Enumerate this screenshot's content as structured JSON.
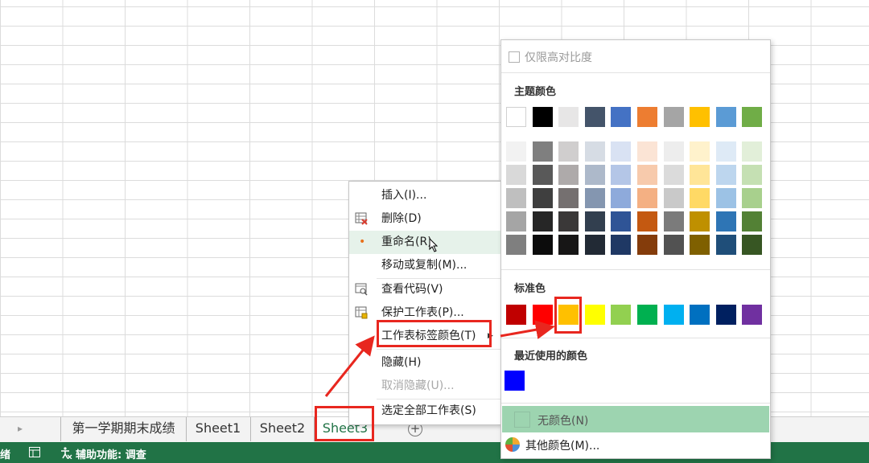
{
  "sheet_tabs": {
    "items": [
      "第一学期期末成绩",
      "Sheet1",
      "Sheet2",
      "Sheet3"
    ],
    "active": "Sheet3",
    "add_icon": "plus-circle-icon",
    "nav_icon": "triangle-right-icon"
  },
  "status_bar": {
    "ready_text": "绪",
    "accessibility_text": "辅助功能: 调查",
    "accessibility_icon": "accessibility-icon",
    "macro_icon": "record-macro-icon",
    "color": "#217346"
  },
  "context_menu": {
    "items": [
      {
        "label": "插入(I)...",
        "icon": ""
      },
      {
        "label": "删除(D)",
        "icon": "delete-sheet-icon"
      },
      {
        "label": "重命名(R)",
        "icon": "bullet-icon"
      },
      {
        "label": "移动或复制(M)...",
        "icon": ""
      },
      {
        "label": "查看代码(V)",
        "icon": "view-code-icon"
      },
      {
        "label": "保护工作表(P)...",
        "icon": "protect-sheet-icon"
      },
      {
        "label": "工作表标签颜色(T)",
        "icon": "submenu-arrow-icon"
      },
      {
        "label": "隐藏(H)",
        "icon": ""
      },
      {
        "label": "取消隐藏(U)...",
        "icon": ""
      },
      {
        "label": "选定全部工作表(S)",
        "icon": ""
      }
    ]
  },
  "palette": {
    "high_contrast_label": "仅限高对比度",
    "theme_heading": "主题颜色",
    "theme_colors": [
      "#FFFFFF",
      "#000000",
      "#E7E6E6",
      "#44546A",
      "#4472C4",
      "#ED7D31",
      "#A5A5A5",
      "#FFC000",
      "#5B9BD5",
      "#70AD47"
    ],
    "theme_shades": [
      [
        "#F2F2F2",
        "#7F7F7F",
        "#D0CECE",
        "#D6DCE4",
        "#D9E2F3",
        "#FBE4D5",
        "#EDEDED",
        "#FFF2CC",
        "#DEEAF6",
        "#E2EFD9"
      ],
      [
        "#D9D9D9",
        "#595959",
        "#AEAAAA",
        "#ADB9CA",
        "#B4C6E7",
        "#F7CAAC",
        "#DBDBDB",
        "#FFE598",
        "#BDD6EE",
        "#C5E0B3"
      ],
      [
        "#BFBFBF",
        "#3F3F3F",
        "#757070",
        "#8496B0",
        "#8EAADB",
        "#F4B083",
        "#C9C9C9",
        "#FFD965",
        "#9CC2E5",
        "#A8D08D"
      ],
      [
        "#A5A5A5",
        "#262626",
        "#3A3838",
        "#323F4F",
        "#2F5496",
        "#C45911",
        "#7B7B7B",
        "#BF9000",
        "#2E75B5",
        "#538135"
      ],
      [
        "#7F7F7F",
        "#0C0C0C",
        "#171616",
        "#222A35",
        "#1F3864",
        "#843C0B",
        "#525252",
        "#7F6000",
        "#1F4E79",
        "#375623"
      ]
    ],
    "standard_heading": "标准色",
    "standard_colors": [
      "#C00000",
      "#FF0000",
      "#FFC000",
      "#FFFF00",
      "#92D050",
      "#00B050",
      "#00B0F0",
      "#0070C0",
      "#002060",
      "#7030A0"
    ],
    "recent_heading": "最近使用的颜色",
    "recent_colors": [
      "#0000FF"
    ],
    "no_color_label": "无颜色(N)",
    "more_colors_label": "其他颜色(M)...",
    "more_colors_icon": "color-wheel-icon"
  },
  "annotation_color": "#E8271F"
}
